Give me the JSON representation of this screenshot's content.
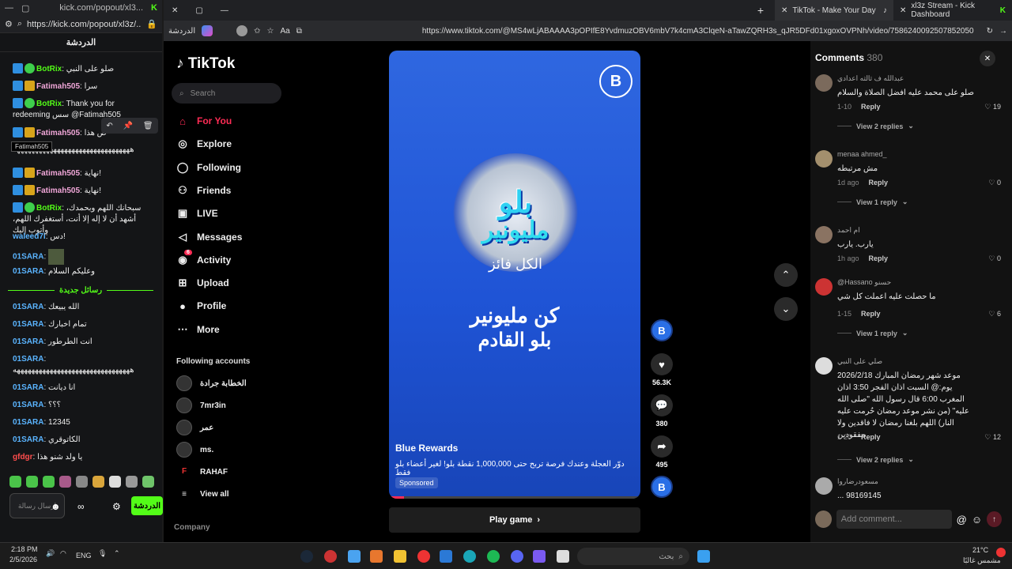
{
  "kick": {
    "tab_title": "kick.com/popout/xl3...",
    "url": "https://kick.com/popout/xl3z/...",
    "chat_title": "الدردشة",
    "messages": [
      {
        "user": "BotRix",
        "text": "صلو على النبي"
      },
      {
        "user": "Fatimah505",
        "text": "سرا"
      },
      {
        "user": "BotRix",
        "text": "Thank you for redeeming سس @Fatimah505"
      },
      {
        "user": "Fatimah505",
        "text": "ص هذا"
      },
      {
        "user": "",
        "text": "ههههههههههههههههههههههههههههههههه"
      },
      {
        "user": "Fatimah505",
        "text": "نهاية!"
      },
      {
        "user": "Fatimah505",
        "text": "نهاية!"
      },
      {
        "user": "BotRix",
        "text": "سبحانك اللهم وبحمدك، أشهد أن لا إله إلا أنت، أستغفرك اللهم، وأتوب إليك"
      },
      {
        "user": "waleed7i",
        "text": "دس!"
      },
      {
        "user": "01SARA",
        "text": ""
      },
      {
        "user": "01SARA",
        "text": "وعليكم السلام"
      }
    ],
    "new_messages_label": "رسائل جديدة",
    "new_messages": [
      {
        "user": "01SARA",
        "text": "الله يبيعك"
      },
      {
        "user": "01SARA",
        "text": "تمام اخبارك"
      },
      {
        "user": "01SARA",
        "text": "انت الطرطور"
      },
      {
        "user": "01SARA",
        "text": "ههههههههههههههههههههههههههههههههه"
      },
      {
        "user": "01SARA",
        "text": "انا ديانت"
      },
      {
        "user": "01SARA",
        "text": "؟؟؟"
      },
      {
        "user": "01SARA",
        "text": "12345"
      },
      {
        "user": "01SARA",
        "text": "الكاتوقري"
      },
      {
        "user": "gfdgr",
        "text": "يا ولد شنو هذا"
      }
    ],
    "tooltip": "Fatimah505",
    "input_placeholder": "إرسال رسالة",
    "send_label": "الدردشة"
  },
  "browser": {
    "tabs": [
      "TikTok - Make Your Day",
      "xl3z Stream - Kick Dashboard"
    ],
    "url": "https://www.tiktok.com/@MS4wLjABAAAA3pOPIfE8YvdmuzOBV6mbV7k4cmA3ClqeN-aTawZQRH3s_qJR5DFd01xgoxOVPNh/video/7586240092507852050",
    "profile_label": "الدردشة"
  },
  "tiktok": {
    "logo": "TikTok",
    "search_placeholder": "Search",
    "nav": [
      "For You",
      "Explore",
      "Following",
      "Friends",
      "LIVE",
      "Messages",
      "Activity",
      "Upload",
      "Profile",
      "More"
    ],
    "activity_badge": "6",
    "following_title": "Following accounts",
    "accounts": [
      "الخطابة جرادة",
      "7mr3in",
      "عمر",
      "ms.",
      "RAHAF"
    ],
    "view_all": "View all",
    "company": "Company"
  },
  "video": {
    "brand_line1": "بلو",
    "brand_line2": "مليونير",
    "brand_sub": "الكل فائز",
    "headline1": "كن مليونير",
    "headline2": "بلو القادم",
    "account": "Blue Rewards",
    "description": "دوّر العجلة وعندك فرصة تربح حتى 1,000,000 نقطة بلو! لغير أعضاء بلو فقط",
    "sponsored": "Sponsored",
    "progress": 0.06,
    "likes": "56.3K",
    "comments": "380",
    "shares": "495",
    "play_label": "Play game"
  },
  "comments": {
    "title": "Comments",
    "count": "380",
    "items": [
      {
        "name": "عبدالله ف ثالثه اعدادي",
        "text": "صلو على محمد عليه افضل الصلاة والسلام",
        "time": "1-10",
        "likes": "19",
        "replies": "View 2 replies"
      },
      {
        "name": "menaa ahmed_",
        "text": "مش مرتبطه",
        "time": "1d ago",
        "likes": "0",
        "replies": "View 1 reply"
      },
      {
        "name": "ام احمد",
        "text": "يارب. يارب",
        "time": "1h ago",
        "likes": "0",
        "replies": ""
      },
      {
        "name": "@Hassano حسنو",
        "text": "ما حصلت عليه اعملت كل شي",
        "time": "1-15",
        "likes": "6",
        "replies": "View 1 reply"
      },
      {
        "name": "صلي على النبي",
        "text": "موعد شهر رمضان المبارك 2026/2/18 يوم:@ السبت اذان الفجر 3:50 اذان المغرب 6:00 قال رسول الله \"صلى الله عليه\" (من نشر موعد رمضان حُرمت عليه النار) اللهم بلغنا رمضان لا فاقدين ولا مفقودين",
        "time": "1-20",
        "likes": "12",
        "replies": "View 2 replies"
      },
      {
        "name": "مسعودرضاروا",
        "text": "98169145 ...",
        "time": "",
        "likes": "",
        "replies": ""
      }
    ],
    "reply_label": "Reply",
    "input_placeholder": "Add comment..."
  },
  "taskbar": {
    "time": "2:18 PM",
    "date": "2/5/2026",
    "lang": "ENG",
    "search_placeholder": "بحث",
    "weather_temp": "21°C",
    "weather_desc": "مشمس غالبًا"
  }
}
